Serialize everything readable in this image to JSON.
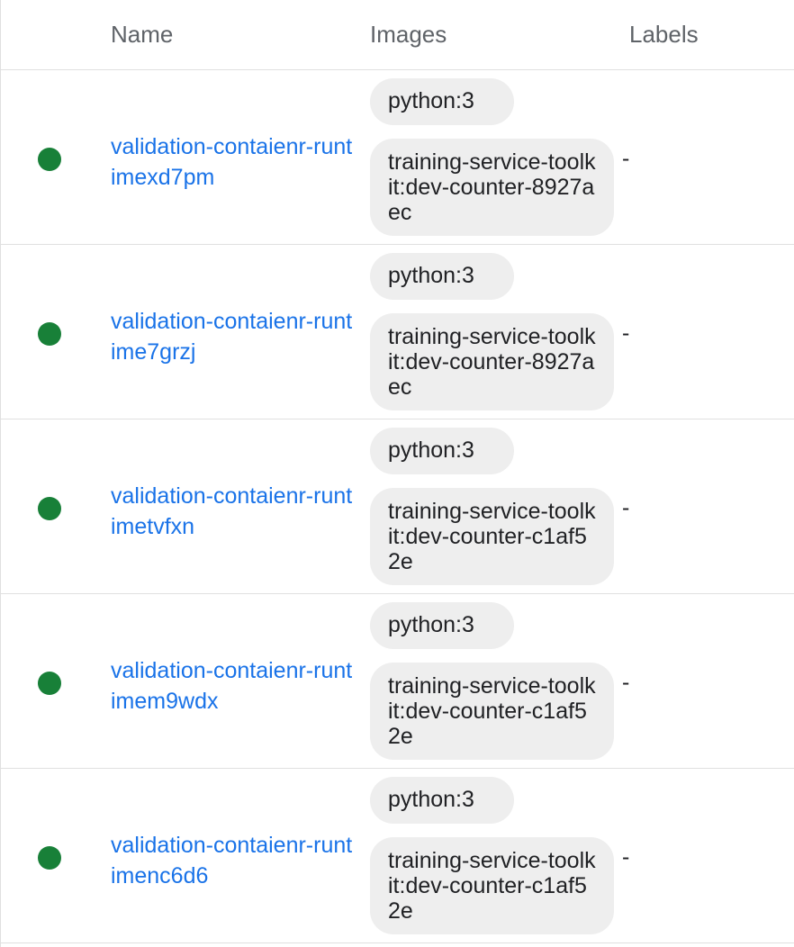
{
  "columns": {
    "name": "Name",
    "images": "Images",
    "labels": "Labels"
  },
  "status_color": "#188038",
  "link_color": "#1a73e8",
  "rows": [
    {
      "status": "running",
      "name": "validation-contaienr-runtimexd7pm",
      "images": [
        "python:3",
        "training-service-toolkit:dev-counter-8927aec"
      ],
      "labels": "-"
    },
    {
      "status": "running",
      "name": "validation-contaienr-runtime7grzj",
      "images": [
        "python:3",
        "training-service-toolkit:dev-counter-8927aec"
      ],
      "labels": "-"
    },
    {
      "status": "running",
      "name": "validation-contaienr-runtimetvfxn",
      "images": [
        "python:3",
        "training-service-toolkit:dev-counter-c1af52e"
      ],
      "labels": "-"
    },
    {
      "status": "running",
      "name": "validation-contaienr-runtimem9wdx",
      "images": [
        "python:3",
        "training-service-toolkit:dev-counter-c1af52e"
      ],
      "labels": "-"
    },
    {
      "status": "running",
      "name": "validation-contaienr-runtimenc6d6",
      "images": [
        "python:3",
        "training-service-toolkit:dev-counter-c1af52e"
      ],
      "labels": "-"
    }
  ]
}
